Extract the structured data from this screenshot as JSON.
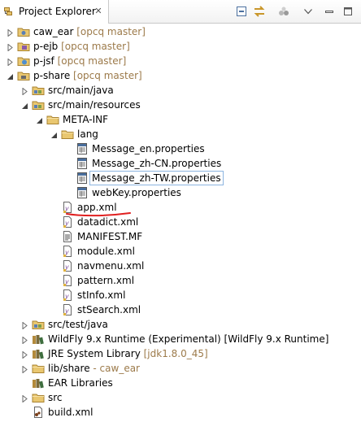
{
  "view": {
    "title": "Project Explorer",
    "close_glyph": "✕",
    "icon": "project-explorer-icon"
  },
  "toolbar": {
    "collapse_icon": "collapse-all-icon",
    "link_icon": "link-with-editor-icon",
    "filter_icon": "filter-icon",
    "menu_icon": "view-menu-icon",
    "minimize_icon": "minimize-icon",
    "maximize_icon": "maximize-icon"
  },
  "tree": [
    {
      "label": "caw_ear",
      "decoration": " [opcq master]",
      "expanded": false,
      "icon": "ear-project-icon"
    },
    {
      "label": "p-ejb",
      "decoration": " [opcq master]",
      "expanded": false,
      "icon": "ejb-project-icon"
    },
    {
      "label": "p-jsf",
      "decoration": " [opcq master]",
      "expanded": false,
      "icon": "web-project-icon"
    },
    {
      "label": "p-share",
      "decoration": " [opcq master]",
      "expanded": true,
      "icon": "utility-project-icon"
    },
    {
      "label": "src/main/java",
      "decoration": "",
      "expanded": false,
      "icon": "source-folder-icon"
    },
    {
      "label": "src/main/resources",
      "decoration": "",
      "expanded": true,
      "icon": "source-folder-icon"
    },
    {
      "label": "META-INF",
      "decoration": "",
      "expanded": true,
      "icon": "folder-icon"
    },
    {
      "label": "lang",
      "decoration": "",
      "expanded": true,
      "icon": "folder-icon"
    },
    {
      "label": "Message_en.properties",
      "decoration": "",
      "icon": "properties-file-icon"
    },
    {
      "label": "Message_zh-CN.properties",
      "decoration": "",
      "icon": "properties-file-icon"
    },
    {
      "label": "Message_zh-TW.properties",
      "decoration": "",
      "icon": "properties-file-icon",
      "selected": true
    },
    {
      "label": "webKey.properties",
      "decoration": "",
      "icon": "properties-file-icon"
    },
    {
      "label": "app.xml",
      "decoration": "",
      "icon": "xml-file-icon"
    },
    {
      "label": "datadict.xml",
      "decoration": "",
      "icon": "xml-file-icon"
    },
    {
      "label": "MANIFEST.MF",
      "decoration": "",
      "icon": "manifest-file-icon"
    },
    {
      "label": "module.xml",
      "decoration": "",
      "icon": "xml-file-icon"
    },
    {
      "label": "navmenu.xml",
      "decoration": "",
      "icon": "xml-file-icon"
    },
    {
      "label": "pattern.xml",
      "decoration": "",
      "icon": "xml-file-icon"
    },
    {
      "label": "stInfo.xml",
      "decoration": "",
      "icon": "xml-file-icon"
    },
    {
      "label": "stSearch.xml",
      "decoration": "",
      "icon": "xml-file-icon"
    },
    {
      "label": "src/test/java",
      "decoration": "",
      "expanded": false,
      "icon": "source-folder-icon"
    },
    {
      "label": "WildFly 9.x Runtime (Experimental) [WildFly 9.x Runtime]",
      "decoration": "",
      "expanded": false,
      "icon": "library-icon"
    },
    {
      "label": "JRE System Library",
      "decoration": " [jdk1.8.0_45]",
      "expanded": false,
      "icon": "library-icon"
    },
    {
      "label": "lib/share",
      "decoration": " - caw_ear",
      "expanded": false,
      "icon": "folder-icon"
    },
    {
      "label": "EAR Libraries",
      "decoration": "",
      "icon": "library-icon"
    },
    {
      "label": "src",
      "decoration": "",
      "expanded": false,
      "icon": "folder-icon"
    },
    {
      "label": "build.xml",
      "decoration": "",
      "icon": "ant-file-icon"
    }
  ],
  "annotation": {
    "underline_color": "#e02020"
  }
}
